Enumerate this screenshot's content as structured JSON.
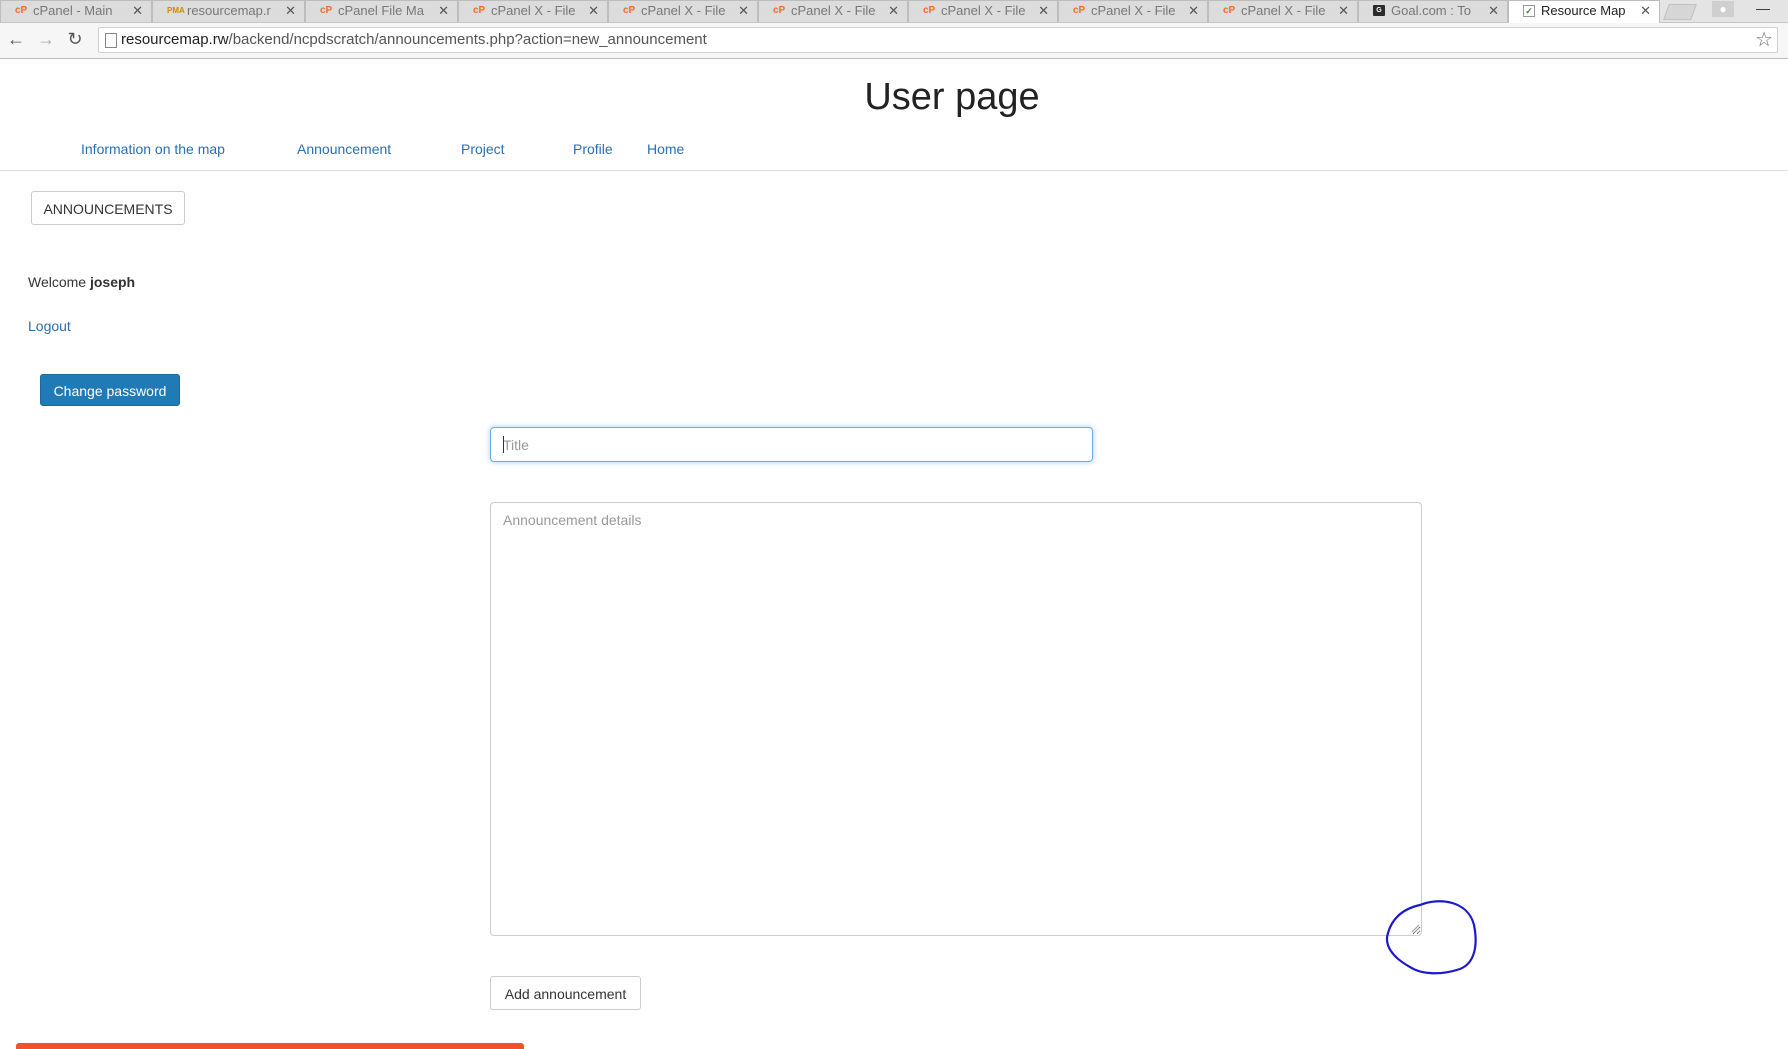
{
  "browser": {
    "tabs": [
      {
        "title": "cPanel - Main",
        "icon": "cpanel-icon",
        "active": false
      },
      {
        "title": "resourcemap.r",
        "icon": "phpmyadmin-icon",
        "active": false
      },
      {
        "title": "cPanel File Ma",
        "icon": "cpanel-icon",
        "active": false
      },
      {
        "title": "cPanel X - File",
        "icon": "cpanel-icon",
        "active": false
      },
      {
        "title": "cPanel X - File",
        "icon": "cpanel-icon",
        "active": false
      },
      {
        "title": "cPanel X - File",
        "icon": "cpanel-icon",
        "active": false
      },
      {
        "title": "cPanel X - File",
        "icon": "cpanel-icon",
        "active": false
      },
      {
        "title": "cPanel X - File",
        "icon": "cpanel-icon",
        "active": false
      },
      {
        "title": "cPanel X - File",
        "icon": "cpanel-icon",
        "active": false
      },
      {
        "title": "Goal.com : To",
        "icon": "goal-icon",
        "active": false
      },
      {
        "title": "Resource Map",
        "icon": "resource-map-icon",
        "active": true
      }
    ],
    "url_host": "resourcemap.rw",
    "url_path": "/backend/ncpdscratch/announcements.php?action=new_announcement"
  },
  "page": {
    "title": "User page",
    "nav": [
      {
        "label": "Information on the map"
      },
      {
        "label": "Announcement"
      },
      {
        "label": "Project"
      },
      {
        "label": "Profile"
      },
      {
        "label": "Home"
      }
    ],
    "announcements_button": "ANNOUNCEMENTS",
    "welcome_prefix": "Welcome",
    "username": "joseph",
    "logout_label": "Logout",
    "change_password_label": "Change password"
  },
  "form": {
    "title_placeholder": "Title",
    "title_value": "",
    "details_placeholder": "Announcement details",
    "details_value": "",
    "submit_label": "Add announcement"
  },
  "colors": {
    "link": "#2a6fb0",
    "primary_button": "#1f7ab6",
    "focus_border": "#66afe9",
    "annotation_circle": "#1a1acc",
    "bottom_bar": "#f0522c"
  }
}
